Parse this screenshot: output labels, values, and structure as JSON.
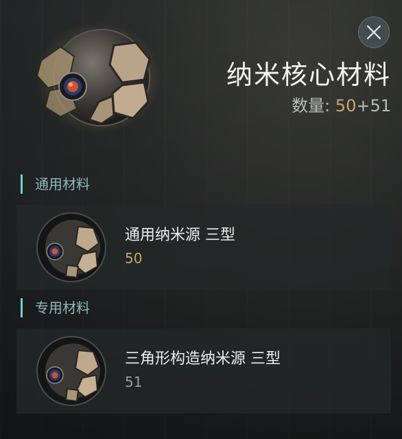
{
  "header": {
    "title": "纳米核心材料",
    "quantity_label": "数量:",
    "quantity_owned": "50",
    "quantity_extra": "+51",
    "close_icon": "close-icon"
  },
  "sections": [
    {
      "label": "通用材料",
      "item": {
        "name": "通用纳米源 三型",
        "count": "50",
        "count_color": "#c9a56a"
      }
    },
    {
      "label": "专用材料",
      "item": {
        "name": "三角形构造纳米源 三型",
        "count": "51",
        "count_color": "#9a9e9e"
      }
    }
  ],
  "colors": {
    "accent": "#6fd3c7",
    "gold": "#c9a56a"
  }
}
